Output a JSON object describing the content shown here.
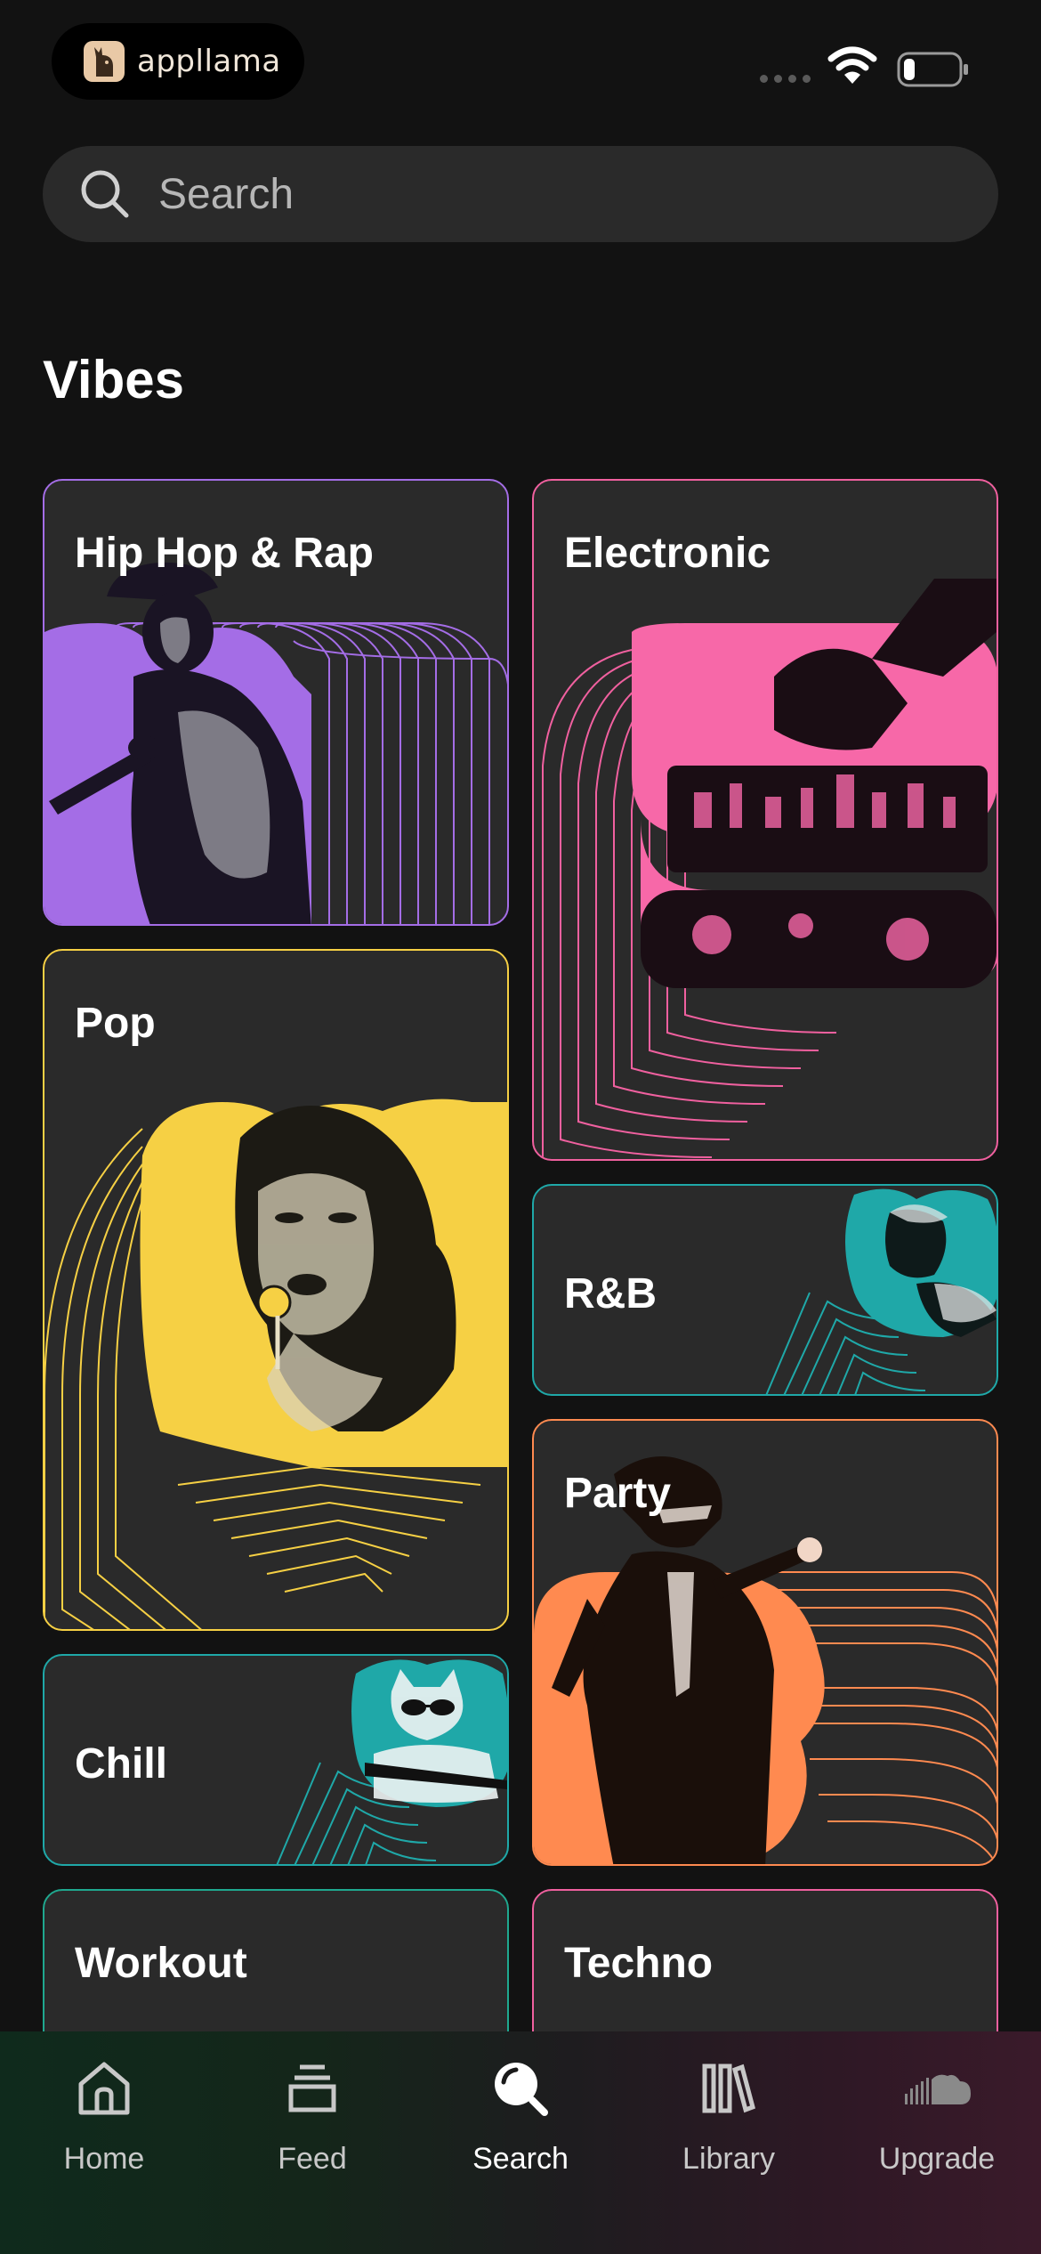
{
  "status_bar": {
    "app_badge": "appllama",
    "logo_icon": "llama-logo-icon",
    "wifi_icon": "wifi-icon",
    "battery_icon": "battery-icon"
  },
  "search": {
    "placeholder": "Search",
    "icon": "search-icon"
  },
  "section": {
    "title": "Vibes"
  },
  "tiles": {
    "hiphop": {
      "label": "Hip Hop & Rap",
      "color": "#a46de6"
    },
    "electronic": {
      "label": "Electronic",
      "color": "#f0609f"
    },
    "pop": {
      "label": "Pop",
      "color": "#f6d044"
    },
    "rnb": {
      "label": "R&B",
      "color": "#1fa8a8"
    },
    "party": {
      "label": "Party",
      "color": "#ff8a50"
    },
    "chill": {
      "label": "Chill",
      "color": "#1fa8a8"
    },
    "workout": {
      "label": "Workout",
      "color": "#1fa88f"
    },
    "techno": {
      "label": "Techno",
      "color": "#f0609f"
    }
  },
  "nav": {
    "items": [
      {
        "label": "Home",
        "icon": "home-icon"
      },
      {
        "label": "Feed",
        "icon": "feed-icon"
      },
      {
        "label": "Search",
        "icon": "search-icon",
        "active": true
      },
      {
        "label": "Library",
        "icon": "library-icon"
      },
      {
        "label": "Upgrade",
        "icon": "cloud-icon"
      }
    ]
  }
}
